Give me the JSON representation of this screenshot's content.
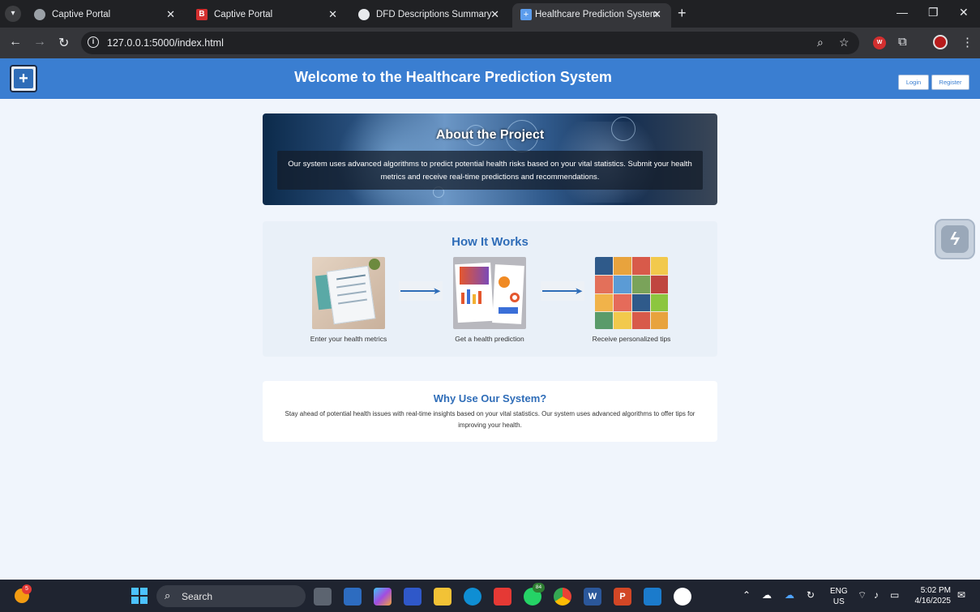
{
  "browser": {
    "tabs": [
      {
        "title": "Captive Portal",
        "favicon": "globe-icon"
      },
      {
        "title": "Captive Portal",
        "favicon": "b-logo-icon"
      },
      {
        "title": "DFD Descriptions Summary",
        "favicon": "openai-icon"
      },
      {
        "title": "Healthcare Prediction System",
        "favicon": "hospital-icon",
        "active": true
      }
    ],
    "url": "127.0.0.1:5000/index.html",
    "extension_w": "W"
  },
  "header": {
    "title": "Welcome to the Healthcare Prediction System",
    "login_label": "Login",
    "register_label": "Register"
  },
  "about": {
    "heading": "About the Project",
    "text": "Our system uses advanced algorithms to predict potential health risks based on your vital statistics. Submit your health metrics and receive real-time predictions and recommendations."
  },
  "how": {
    "heading": "How It Works",
    "steps": [
      {
        "label": "Enter your health metrics"
      },
      {
        "label": "Get a health prediction"
      },
      {
        "label": "Receive personalized tips"
      }
    ]
  },
  "why": {
    "heading": "Why Use Our System?",
    "text": "Stay ahead of potential health issues with real-time insights based on your vital statistics. Our system uses advanced algorithms to offer tips for improving your health."
  },
  "taskbar": {
    "weather_badge": "5",
    "search_label": "Search",
    "whatsapp_badge": "84",
    "lang_line1": "ENG",
    "lang_line2": "US",
    "time": "5:02 PM",
    "date": "4/16/2025"
  },
  "colors": {
    "header_blue": "#3a7ed1",
    "heading_blue": "#2f6db8",
    "page_bg": "#f0f5fc"
  }
}
